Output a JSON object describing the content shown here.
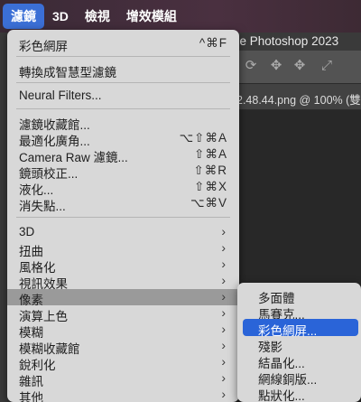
{
  "menubar": {
    "items": [
      "濾鏡",
      "3D",
      "檢視",
      "增效模組"
    ]
  },
  "app": {
    "title_partial": "be Photoshop 2023",
    "tab_partial": "2.48.44.png @ 100% (雙",
    "toolbar_icons": [
      "rotate-3d-icon",
      "pan-3d-icon",
      "slide-3d-icon",
      "scale-3d-icon"
    ]
  },
  "filter_menu": {
    "items": [
      {
        "label": "彩色網屏",
        "shortcut": "^⌘F"
      },
      {
        "label": "轉換成智慧型濾鏡"
      },
      {
        "label": "Neural Filters..."
      },
      {
        "label": "濾鏡收藏館..."
      },
      {
        "label": "最適化廣角...",
        "shortcut": "⌥⇧⌘A"
      },
      {
        "label": "Camera Raw 濾鏡...",
        "shortcut": "⇧⌘A"
      },
      {
        "label": "鏡頭校正...",
        "shortcut": "⇧⌘R"
      },
      {
        "label": "液化...",
        "shortcut": "⇧⌘X"
      },
      {
        "label": "消失點...",
        "shortcut": "⌥⌘V"
      },
      {
        "label": "3D"
      },
      {
        "label": "扭曲"
      },
      {
        "label": "風格化"
      },
      {
        "label": "視訊效果"
      },
      {
        "label": "像素"
      },
      {
        "label": "演算上色"
      },
      {
        "label": "模糊"
      },
      {
        "label": "模糊收藏館"
      },
      {
        "label": "銳利化"
      },
      {
        "label": "雜訊"
      },
      {
        "label": "其他"
      }
    ],
    "highlighted": "像素"
  },
  "pixelate_submenu": {
    "items": [
      "多面體",
      "馬賽克...",
      "彩色網屏...",
      "殘影",
      "結晶化...",
      "網線銅版...",
      "點狀化..."
    ],
    "selected": "彩色網屏..."
  }
}
